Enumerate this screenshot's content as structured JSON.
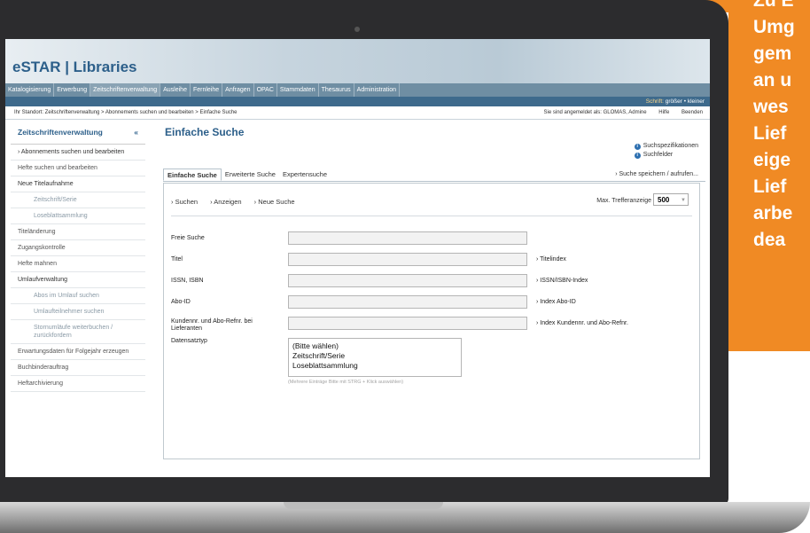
{
  "app": {
    "title": "eSTAR | Libraries"
  },
  "menu": {
    "items": [
      "Katalogisierung",
      "Erwerbung",
      "Zeitschriftenverwaltung",
      "Ausleihe",
      "Fernleihe",
      "Anfragen",
      "OPAC",
      "Stammdaten",
      "Thesaurus",
      "Administration"
    ],
    "active_index": 2
  },
  "fontbar": {
    "label": "Schrift:",
    "larger": "größer",
    "separator": "•",
    "smaller": "kleiner"
  },
  "location": {
    "breadcrumb": "Ihr Standort: Zeitschriftenverwaltung > Abonnements suchen und bearbeiten > Einfache Suche",
    "logged_in": "Sie sind angemeldet als: GLOMAS, Admine",
    "help": "Hilfe",
    "quit": "Beenden"
  },
  "sidebar": {
    "title": "Zeitschriftenverwaltung",
    "collapse": "«",
    "items": [
      "Abonnements suchen und bearbeiten",
      "Hefte suchen und bearbeiten",
      "Neue Titelaufnahme",
      "Zeitschrift/Serie",
      "Loseblattsammlung",
      "Titeländerung",
      "Zugangskontrolle",
      "Hefte mahnen",
      "Umlaufverwaltung",
      "Abos im Umlauf suchen",
      "Umlaufteilnehmer suchen",
      "Stornumläufe weiterbuchen / zurückfordern",
      "Erwartungsdaten für Folgejahr erzeugen",
      "Buchbinderauftrag",
      "Heftarchivierung"
    ]
  },
  "main": {
    "title": "Einfache Suche",
    "help_links": [
      "Suchspezifikationen",
      "Suchfelder"
    ],
    "tabs": [
      "Einfache Suche",
      "Erweiterte Suche",
      "Expertensuche"
    ],
    "save_link": "Suche speichern / aufrufen...",
    "actions": [
      "Suchen",
      "Anzeigen",
      "Neue Suche"
    ],
    "max_hits_label": "Max. Trefferanzeige",
    "max_hits_value": "500",
    "fields": {
      "freie_suche": "Freie Suche",
      "titel": "Titel",
      "issn": "ISSN, ISBN",
      "abo_id": "Abo-ID",
      "kunden": "Kundennr. und Abo-Refnr. bei Lieferanten",
      "datensatztyp": "Datensatztyp"
    },
    "links": {
      "titel": "Titelindex",
      "issn": "ISSN/ISBN-Index",
      "abo_id": "Index Abo-ID",
      "kunden": "Index Kundennr. und Abo-Refnr."
    },
    "datensatztyp_options": [
      "(Bitte wählen)",
      "Zeitschrift/Serie",
      "Loseblattsammlung"
    ],
    "hint": "(Mehrere Einträge Bitte mit STRG + Klick auswählen)"
  },
  "promo": {
    "lines": [
      "Zu E",
      "Umg",
      "gem",
      "an u",
      "wes",
      "Lief",
      "eige",
      "Lief",
      "arbe",
      "dea"
    ]
  },
  "colors": {
    "orange": "#f08a24",
    "brand_blue": "#2c5f8a",
    "menubar": "#6f8ea3"
  }
}
